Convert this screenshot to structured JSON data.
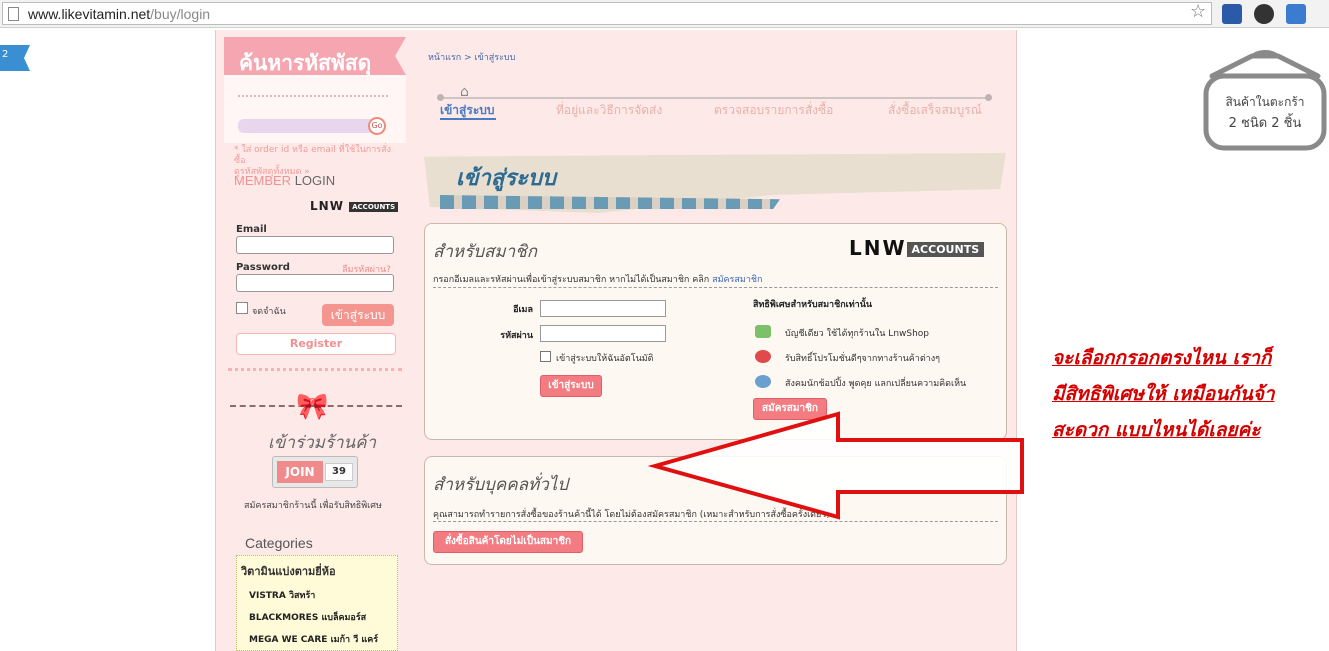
{
  "browser": {
    "url_domain": "www.likevitamin.net",
    "url_path": "/buy/login"
  },
  "edge_badge": "2",
  "sidebar": {
    "track_title": "ค้นหารหัสพัสดุ",
    "track_go": "Go",
    "track_note": "* ใส่ order id หรือ email ที่ใช้ในการสั่งซื้อ",
    "track_note2": "ดูรหัสพัสดุทั้งหมด »",
    "member": "MEMBER",
    "login": "LOGIN",
    "lnw": "LNW",
    "accounts": "ACCOUNTS",
    "email_label": "Email",
    "password_label": "Password",
    "forgot": "ลืมรหัสผ่าน?",
    "remember": "จดจำฉัน",
    "login_button": "เข้าสู่ระบบ",
    "register_button": "Register",
    "join_title": "เข้าร่วมร้านค้า",
    "join_label": "JOIN",
    "join_count": "39",
    "join_note": "สมัครสมาชิกร้านนี้ เพื่อรับสิทธิพิเศษ",
    "categories_title": "Categories",
    "category_head": "วิตามินแบ่งตามยี่ห้อ",
    "categories": [
      "VISTRA วิสทร้า",
      "BLACKMORES แบล็คมอร์ส",
      "MEGA WE CARE เมก้า วี แคร์"
    ]
  },
  "breadcrumb": "หน้าแรก > เข้าสู่ระบบ",
  "steps": [
    "เข้าสู่ระบบ",
    "ที่อยู่และวิธีการจัดส่ง",
    "ตรวจสอบรายการสั่งซื้อ",
    "สั่งซื้อเสร็จสมบูรณ์"
  ],
  "banner_title": "เข้าสู่ระบบ",
  "member_panel": {
    "title": "สำหรับสมาชิก",
    "lnw": "LNW",
    "accounts": "ACCOUNTS",
    "desc": "กรอกอีเมลและรหัสผ่านเพื่อเข้าสู่ระบบสมาชิก หากไม่ได้เป็นสมาชิก คลิก",
    "desc_link": "สมัครสมาชิก",
    "email_label": "อีเมล",
    "password_label": "รหัสผ่าน",
    "remember": "เข้าสู่ระบบให้ฉันอัตโนมัติ",
    "login_button": "เข้าสู่ระบบ",
    "perks_head": "สิทธิพิเศษสำหรับสมาชิกเท่านั้น",
    "perks": [
      "บัญชีเดียว ใช้ได้ทุกร้านใน LnwShop",
      "รับสิทธิ์โปรโมชั่นดีๆจากทางร้านค้าต่างๆ",
      "สังคมนักช้อปปิ้ง พูดคุย แลกเปลี่ยนความคิดเห็น"
    ],
    "register_button": "สมัครสมาชิก"
  },
  "guest_panel": {
    "title": "สำหรับบุคคลทั่วไป",
    "desc": "คุณสามารถทำรายการสั่งซื้อของร้านค้านี้ได้ โดยไม่ต้องสมัครสมาชิก (เหมาะสำหรับการสั่งซื้อครั้งเดียว)",
    "button": "สั่งซื้อสินค้าโดยไม่เป็นสมาชิก"
  },
  "annotation": "จะเลือกกรอกตรงไหน เราก็มีสิทธิพิเศษให้ เหมือนกันจ้า สะดวก แบบไหนได้เลยค่ะ",
  "cart": {
    "line1": "สินค้าในตะกร้า",
    "line2": "2 ชนิด 2 ชิ้น"
  },
  "colors": {
    "accent_pink": "#f37b82",
    "link_blue": "#3a63b8",
    "annotation_red": "#d40000",
    "page_bg": "#fdeae8"
  }
}
